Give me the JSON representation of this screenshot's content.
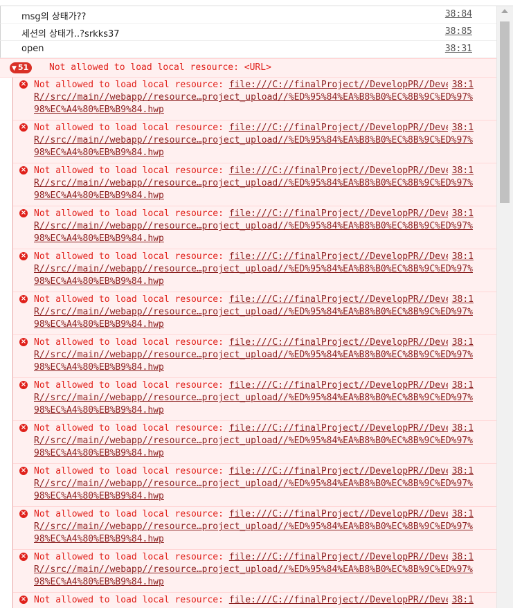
{
  "logs": [
    {
      "text": "msg의 상태가??",
      "link": "38:84"
    },
    {
      "text": "세션의 상태가..?srkks37",
      "link": "38:85"
    },
    {
      "text": "open",
      "link": "38:31"
    }
  ],
  "group": {
    "count": "51",
    "message": "Not allowed to load local resource: <URL>"
  },
  "error_prefix": "Not allowed to load local resource: ",
  "error_url": "file:///C://finalProject//DevelopPR//DevelopPR//src//main//webapp//resource…project_upload//%ED%95%84%EA%B8%B0%EC%8B%9C%ED%97%98%EC%A4%80%EB%B9%84.hwp",
  "error_link": "38:1",
  "error_rows": 13,
  "colors": {
    "error_text": "#e0201a",
    "error_background": "#fff0f0",
    "badge": "#d93026"
  }
}
